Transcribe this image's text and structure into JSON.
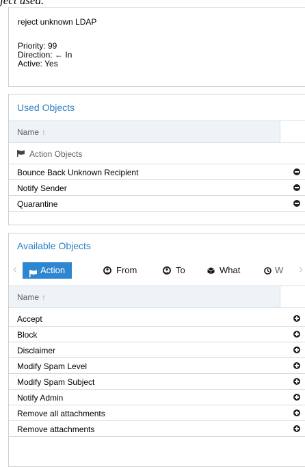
{
  "top_cut_text": "ject used.",
  "summary": {
    "title": "reject unknown LDAP",
    "priority": "Priority: 99",
    "direction_prefix": "Direction:",
    "direction_arrow": "←",
    "direction_value": "In",
    "active": "Active: Yes"
  },
  "used": {
    "header": "Used Objects",
    "column": "Name",
    "sort_arrow": "↑",
    "group": "Action Objects",
    "rows": [
      "Bounce Back Unknown Recipient",
      "Notify Sender",
      "Quarantine"
    ]
  },
  "available": {
    "header": "Available Objects",
    "tabs": [
      "Action",
      "From",
      "To",
      "What",
      "W"
    ],
    "left_arrow": "‹",
    "right_arrow": "›",
    "column": "Name",
    "sort_arrow": "↑",
    "rows": [
      "Accept",
      "Block",
      "Disclaimer",
      "Modify Spam Level",
      "Modify Spam Subject",
      "Notify Admin",
      "Remove all attachments",
      "Remove attachments"
    ]
  },
  "colors": {
    "accent": "#2e86d0",
    "header_text": "#2e7fc4",
    "grid_head": "#eef3f8"
  },
  "icons": [
    "flag-icon",
    "user-icon",
    "package-icon",
    "clock-icon",
    "remove-icon",
    "add-icon"
  ]
}
